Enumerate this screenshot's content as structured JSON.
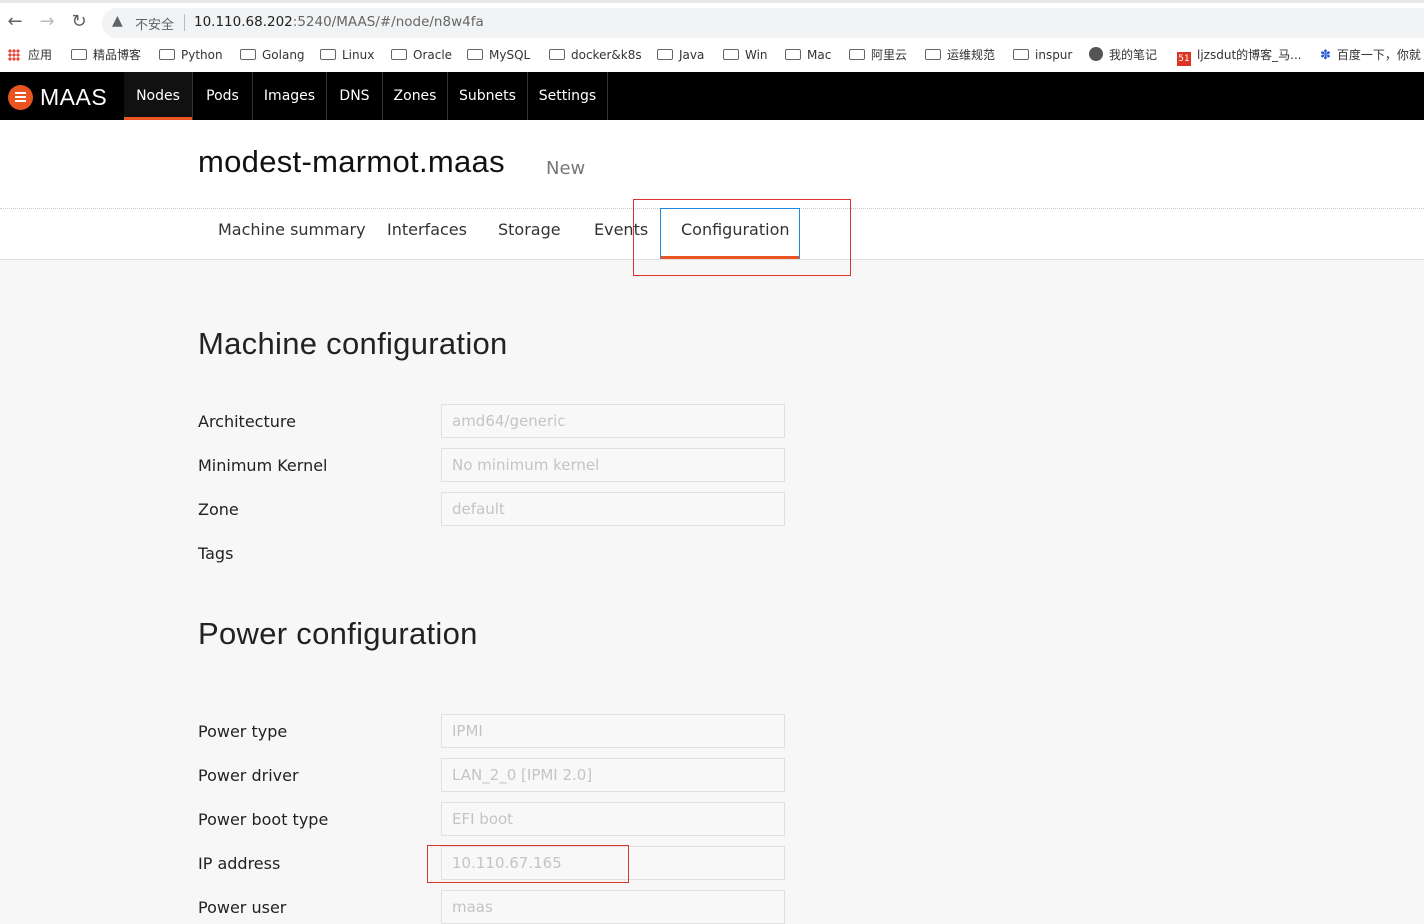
{
  "browser": {
    "back_icon": "back-arrow-icon",
    "forward_icon": "forward-arrow-icon",
    "reload_icon": "reload-icon",
    "security_label": "不安全",
    "url_host": "10.110.68.202",
    "url_path": ":5240/MAAS/#/node/n8w4fa",
    "bookmarks": [
      "应用",
      "精品博客",
      "Python",
      "Golang",
      "Linux",
      "Oracle",
      "MySQL",
      "docker&k8s",
      "Java",
      "Win",
      "Mac",
      "阿里云",
      "运维规范",
      "inspur",
      "我的笔记",
      "ljzsdut的博客_马...",
      "百度一下，你就"
    ]
  },
  "app": {
    "logo_text": "MAAS",
    "brand_color": "#e95420",
    "nav": [
      "Nodes",
      "Pods",
      "Images",
      "DNS",
      "Zones",
      "Subnets",
      "Settings"
    ],
    "active_nav": "Nodes"
  },
  "node": {
    "title": "modest-marmot.maas",
    "status": "New",
    "tabs": [
      "Machine summary",
      "Interfaces",
      "Storage",
      "Events",
      "Configuration"
    ],
    "active_tab": "Configuration"
  },
  "machine_config": {
    "title": "Machine configuration",
    "fields": [
      {
        "label": "Architecture",
        "value": "amd64/generic"
      },
      {
        "label": "Minimum Kernel",
        "value": "No minimum kernel"
      },
      {
        "label": "Zone",
        "value": "default"
      },
      {
        "label": "Tags",
        "value": ""
      }
    ]
  },
  "power_config": {
    "title": "Power configuration",
    "fields": [
      {
        "label": "Power type",
        "value": "IPMI"
      },
      {
        "label": "Power driver",
        "value": "LAN_2_0 [IPMI 2.0]"
      },
      {
        "label": "Power boot type",
        "value": "EFI boot"
      },
      {
        "label": "IP address",
        "value": "10.110.67.165"
      },
      {
        "label": "Power user",
        "value": "maas"
      }
    ]
  },
  "annotation_color": "#d9372a"
}
